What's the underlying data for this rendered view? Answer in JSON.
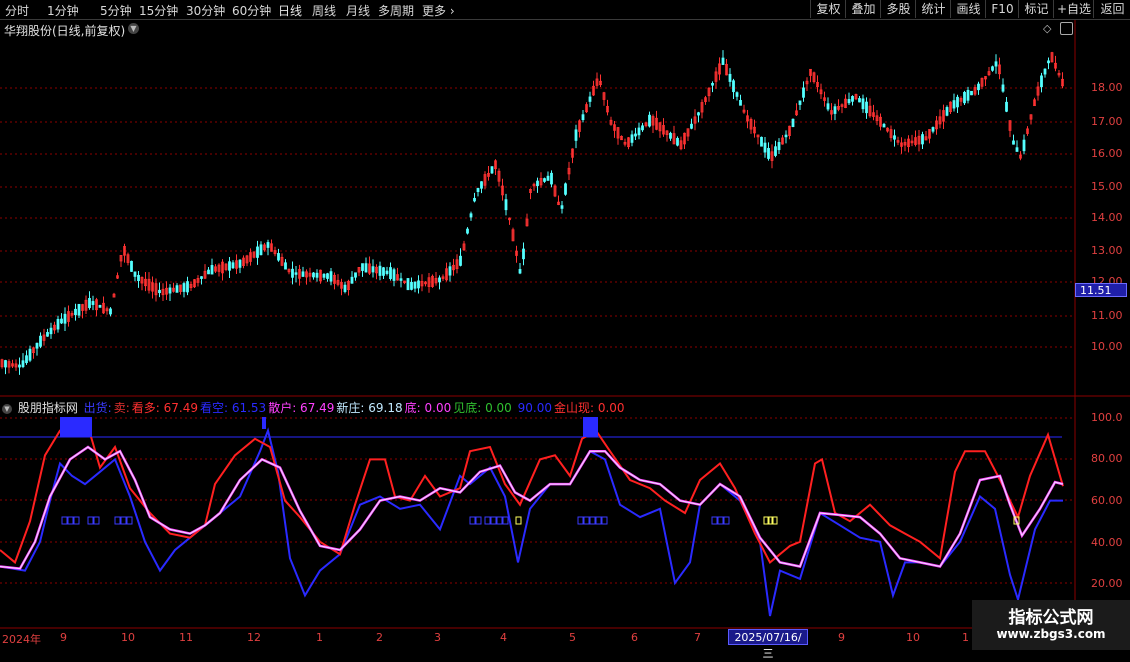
{
  "toolbar": {
    "periods": [
      "分时",
      "1分钟",
      "5分钟",
      "15分钟",
      "30分钟",
      "60分钟",
      "日线",
      "周线",
      "月线",
      "多周期",
      "更多"
    ],
    "buttons": [
      "复权",
      "叠加",
      "多股",
      "统计",
      "画线",
      "F10",
      "标记",
      "+自选",
      "返回"
    ]
  },
  "stock": {
    "title": "华翔股份(日线,前复权)",
    "current_price_tag": "11.51"
  },
  "price_axis": [
    "18.00",
    "17.00",
    "16.00",
    "15.00",
    "14.00",
    "13.00",
    "12.00",
    "11.00",
    "10.00"
  ],
  "indicator": {
    "name": "股朋指标网",
    "items": [
      {
        "label": "出货:",
        "value": "",
        "color": "#3a3aff"
      },
      {
        "label": "卖:",
        "value": "",
        "color": "#e03030"
      },
      {
        "label": "看多:",
        "value": "67.49",
        "color": "#ff3030"
      },
      {
        "label": "看空:",
        "value": "61.53",
        "color": "#2a2aff"
      },
      {
        "label": "散户:",
        "value": "67.49",
        "color": "#ff40ff"
      },
      {
        "label": "新庄:",
        "value": "69.18",
        "color": "#c0e8ff"
      },
      {
        "label": "底:",
        "value": "0.00",
        "color": "#ff40ff"
      },
      {
        "label": "见底:",
        "value": "0.00",
        "color": "#30c030"
      },
      {
        "label": "",
        "value": "90.00",
        "color": "#2a2aff"
      },
      {
        "label": "金山现:",
        "value": "0.00",
        "color": "#ff3030"
      }
    ],
    "axis": [
      "100.0",
      "80.00",
      "60.00",
      "40.00",
      "20.00"
    ]
  },
  "date_axis": {
    "labels": [
      "2024年",
      "9",
      "10",
      "11",
      "12",
      "1",
      "2",
      "3",
      "4",
      "5",
      "6",
      "7",
      "9",
      "10",
      "1"
    ],
    "cursor_date": "2025/07/16/三"
  },
  "watermark": {
    "title": "指标公式网",
    "url": "www.zbgs3.com"
  },
  "colors": {
    "up": "#ff3232",
    "down": "#54ffff",
    "grid": "#8b0000",
    "axis_text": "#e04040",
    "blue_line": "#2a2aff",
    "red_line": "#ff2020",
    "magenta_line": "#ff40ff",
    "white_line": "#e8e8ff"
  }
}
